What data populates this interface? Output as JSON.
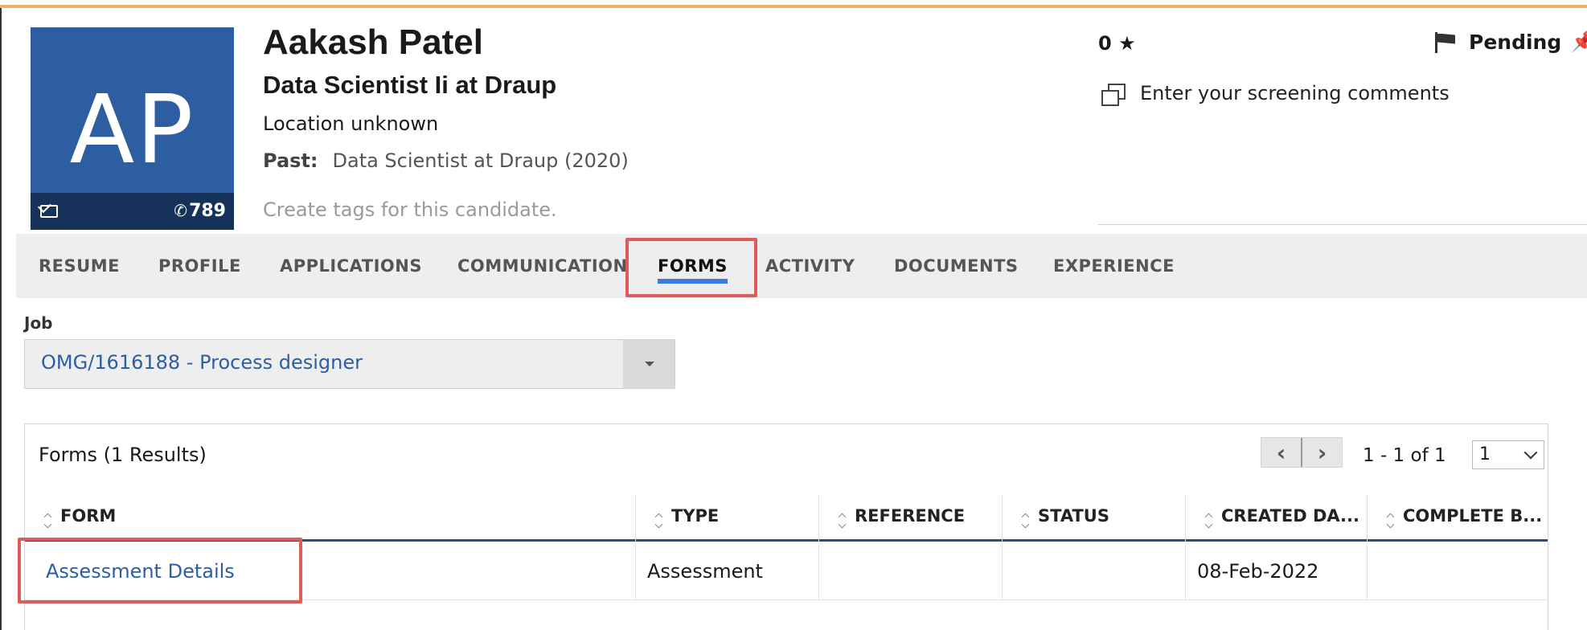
{
  "candidate": {
    "initials": "AP",
    "name": "Aakash Patel",
    "title": "Data Scientist Ii at Draup",
    "location": "Location unknown",
    "past_label": "Past:",
    "past_value": "Data Scientist at Draup (2020)",
    "tags_placeholder": "Create tags for this candidate.",
    "phone": "789",
    "rating": "0",
    "status": "Pending",
    "screening_placeholder": "Enter your screening comments"
  },
  "tabs": [
    {
      "label": "RESUME"
    },
    {
      "label": "PROFILE"
    },
    {
      "label": "APPLICATIONS"
    },
    {
      "label": "COMMUNICATION"
    },
    {
      "label": "FORMS",
      "active": true
    },
    {
      "label": "ACTIVITY"
    },
    {
      "label": "DOCUMENTS"
    },
    {
      "label": "EXPERIENCE"
    }
  ],
  "job": {
    "label": "Job",
    "selected": "OMG/1616188 - Process designer"
  },
  "forms": {
    "title": "Forms (1 Results)",
    "page_range": "1 - 1 of 1",
    "page_number": "1",
    "columns": [
      "FORM",
      "TYPE",
      "REFERENCE",
      "STATUS",
      "CREATED DA...",
      "COMPLETE B..."
    ],
    "rows": [
      {
        "form": "Assessment Details",
        "type": "Assessment",
        "reference": "",
        "status": "",
        "created": "08-Feb-2022",
        "complete_by": ""
      }
    ]
  },
  "colors": {
    "accent_blue": "#2d5ea1",
    "tab_underline": "#3d7ae0",
    "highlight_red": "#de5b5b"
  }
}
